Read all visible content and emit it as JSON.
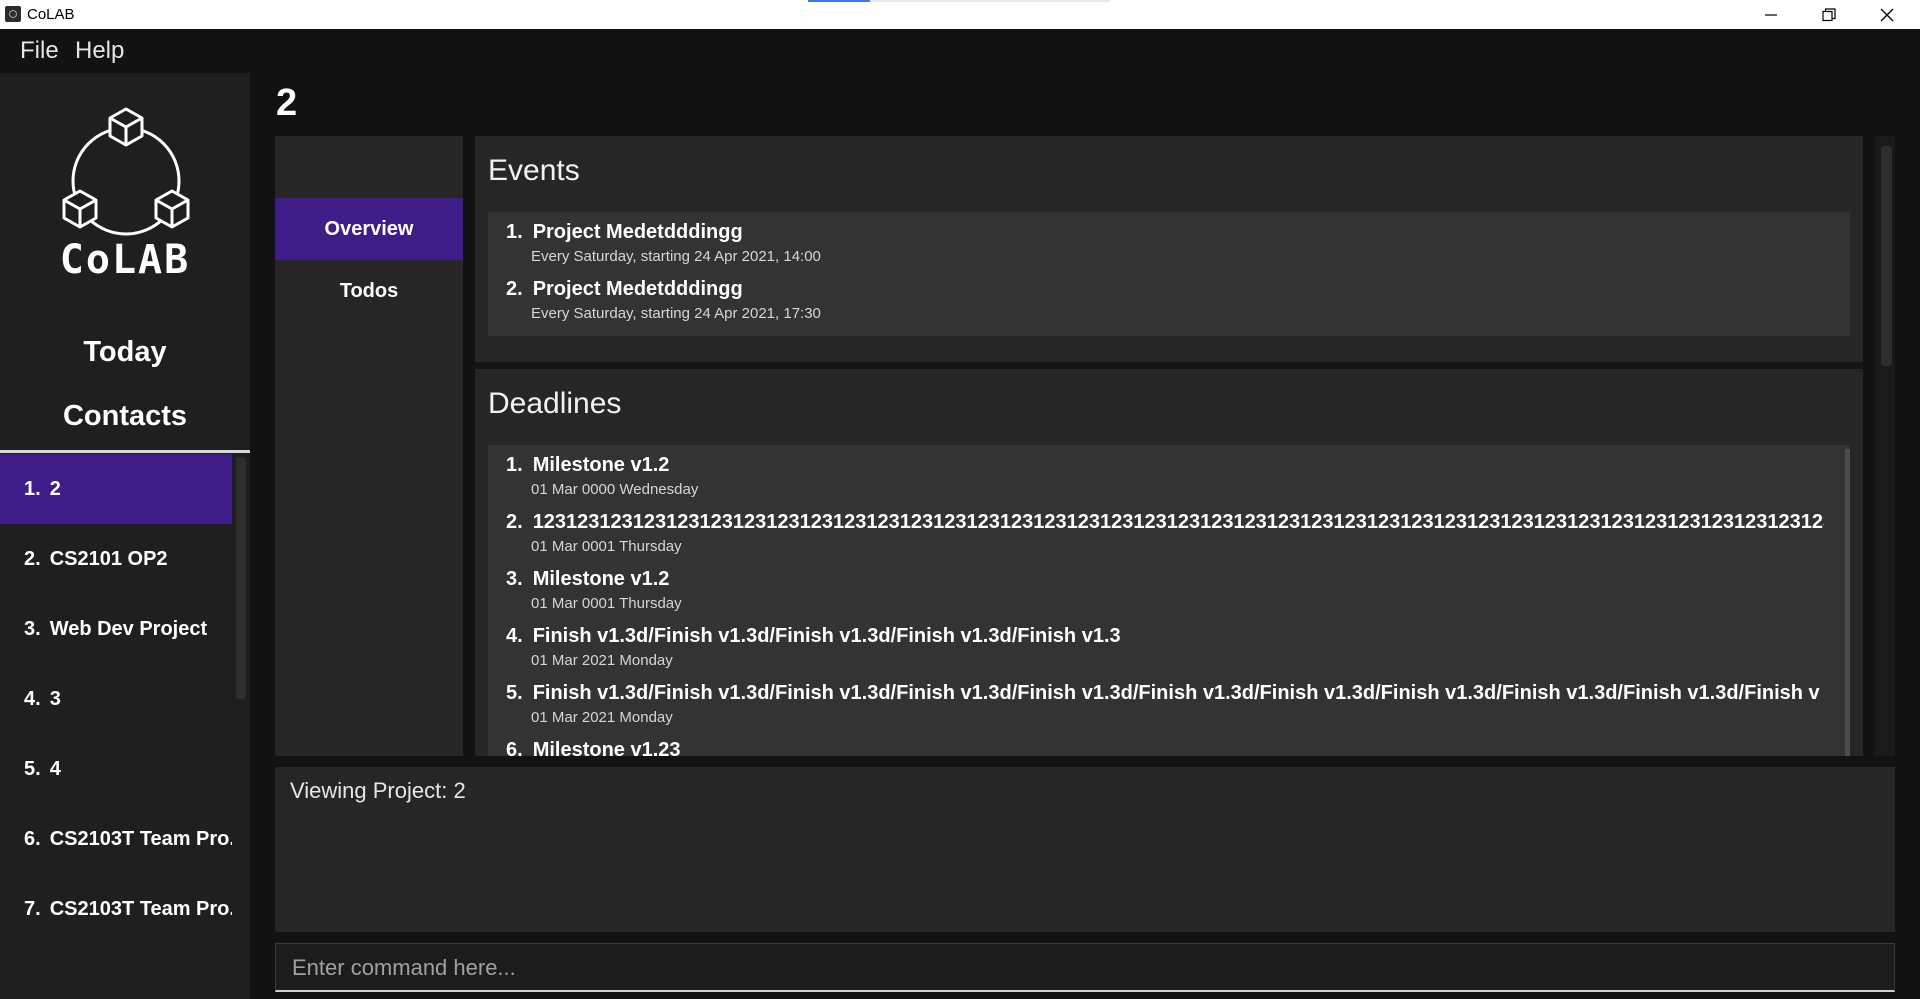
{
  "window": {
    "title": "CoLAB",
    "icons": {
      "minimize": "minimize-icon",
      "restore": "restore-icon",
      "close": "close-icon"
    }
  },
  "menu": {
    "file": "File",
    "help": "Help"
  },
  "sidebar": {
    "logo_text": "CoLAB",
    "nav_today": "Today",
    "nav_contacts": "Contacts",
    "projects": [
      {
        "num": "1.",
        "name": "2",
        "selected": true
      },
      {
        "num": "2.",
        "name": "CS2101 OP2"
      },
      {
        "num": "3.",
        "name": "Web Dev Project"
      },
      {
        "num": "4.",
        "name": "3"
      },
      {
        "num": "5.",
        "name": "4"
      },
      {
        "num": "6.",
        "name": "CS2103T Team Pro.."
      },
      {
        "num": "7.",
        "name": "CS2103T Team Pro.."
      }
    ]
  },
  "main": {
    "project_title": "2",
    "tabs": [
      {
        "label": "Overview",
        "active": true
      },
      {
        "label": "Todos"
      }
    ],
    "events": {
      "title": "Events",
      "items": [
        {
          "num": "1.",
          "name": "Project Medetdddingg",
          "detail": "Every Saturday, starting 24 Apr 2021, 14:00"
        },
        {
          "num": "2.",
          "name": "Project Medetdddingg",
          "detail": "Every Saturday, starting 24 Apr 2021, 17:30"
        }
      ]
    },
    "deadlines": {
      "title": "Deadlines",
      "items": [
        {
          "num": "1.",
          "name": "Milestone v1.2",
          "detail": "01 Mar 0000  Wednesday"
        },
        {
          "num": "2.",
          "name": "123123123123123123123123123123123123123123123123123123123123123123123123123123123123123123123123123123123123123123123123123123123123123123123",
          "detail": "01 Mar 0001  Thursday"
        },
        {
          "num": "3.",
          "name": "Milestone v1.2",
          "detail": "01 Mar 0001  Thursday"
        },
        {
          "num": "4.",
          "name": "Finish v1.3d/Finish v1.3d/Finish v1.3d/Finish v1.3d/Finish v1.3",
          "detail": "01 Mar 2021  Monday"
        },
        {
          "num": "5.",
          "name": "Finish v1.3d/Finish v1.3d/Finish v1.3d/Finish v1.3d/Finish v1.3d/Finish v1.3d/Finish v1.3d/Finish v1.3d/Finish v1.3d/Finish v1.3d/Finish v",
          "detail": "01 Mar 2021  Monday"
        },
        {
          "num": "6.",
          "name": "Milestone v1.23",
          "detail": ""
        }
      ]
    }
  },
  "result": {
    "text": "Viewing Project: 2"
  },
  "command": {
    "placeholder": "Enter command here..."
  },
  "colors": {
    "accent": "#3f1d88",
    "background": "#121212",
    "panel": "#262626",
    "card": "#333333"
  }
}
